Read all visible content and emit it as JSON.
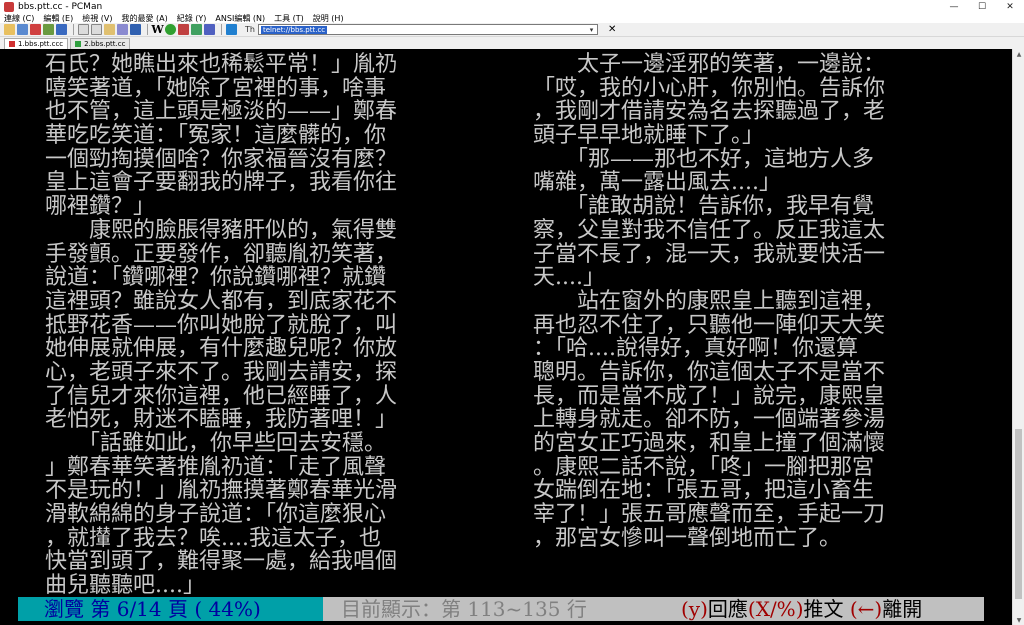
{
  "window": {
    "title": "bbs.ptt.cc - PCMan",
    "controls": [
      "—",
      "☐",
      "✕"
    ]
  },
  "menu": {
    "items": [
      "連線 (C)",
      "編輯 (E)",
      "檢視 (V)",
      "我的最愛 (A)",
      "紀錄 (Y)",
      "ANSI編輯 (N)",
      "工具 (T)",
      "說明 (H)"
    ]
  },
  "toolbar": {
    "address_label": "Th",
    "address_value": "telnet://bbs.ptt.cc",
    "close_label": "✕",
    "w_label": "W"
  },
  "tabs": [
    {
      "label": "1.bbs.ptt.ccc"
    },
    {
      "label": "2.bbs.ptt.cc"
    }
  ],
  "article": {
    "left_lines": [
      "石氏？她瞧出來也稀鬆平常！」胤礽",
      "嘻笑著道，「她除了宮裡的事，啥事",
      "也不管，這上頭是極淡的——」鄭春",
      "華吃吃笑道：「冤家！這麼髒的，你",
      "一個勁掏摸個啥？你家福晉沒有麼？",
      "皇上這會子要翻我的牌子，我看你往",
      "哪裡鑽？」",
      "　　康熙的臉脹得豬肝似的，氣得雙",
      "手發顫。正要發作，卻聽胤礽笑著，",
      "說道：「鑽哪裡？你說鑽哪裡？就鑽",
      "這裡頭？雖說女人都有，到底家花不",
      "抵野花香——你叫她脫了就脫了，叫",
      "她伸展就伸展，有什麼趣兒呢？你放",
      "心，老頭子來不了。我剛去請安，探",
      "了信兒才來你這裡，他已經睡了，人",
      "老怕死，財迷不瞌睡，我防著哩！」",
      "　　「話雖如此，你早些回去安穩。",
      "」鄭春華笑著推胤礽道：「走了風聲",
      "不是玩的！」胤礽撫摸著鄭春華光滑",
      "滑軟綿綿的身子說道：「你這麼狠心",
      "，就攆了我去？唉....我這太子，也",
      "快當到頭了，難得聚一處，給我唱個",
      "曲兒聽聽吧....」"
    ],
    "right_lines": [
      "　　太子一邊淫邪的笑著，一邊說：",
      "「哎，我的小心肝，你別怕。告訴你",
      "，我剛才借請安為名去探聽過了，老",
      "頭子早早地就睡下了。」",
      "　　「那——那也不好，這地方人多",
      "嘴雜，萬一露出風去....」",
      "　　「誰敢胡說！告訴你，我早有覺",
      "察，父皇對我不信任了。反正我這太",
      "子當不長了，混一天，我就要快活一",
      "天....」",
      "　　站在窗外的康熙皇上聽到這裡，",
      "再也忍不住了，只聽他一陣仰天大笑",
      "：「哈....說得好，真好啊！你還算",
      "聰明。告訴你，你這個太子不是當不",
      "長，而是當不成了！」說完，康熙皇",
      "上轉身就走。卻不防，一個端著參湯",
      "的宮女正巧過來，和皇上撞了個滿懷",
      "。康熙二話不說，「咚」一腳把那宮",
      "女踹倒在地：「張五哥，把這小畜生",
      "宰了！」張五哥應聲而至，手起一刀",
      "，那宮女慘叫一聲倒地而亡了。"
    ]
  },
  "status": {
    "browse": "瀏覽 第 6/14 頁 ( 44%)",
    "display": "目前顯示：第 113~135 行",
    "reply_key": "(y)",
    "reply_label": "回應",
    "push_key": "(X/%)",
    "push_label": "推文",
    "leave_key": "(←)",
    "leave_label": "離開"
  },
  "colors": {
    "terminal_bg": "#000000",
    "terminal_fg": "#c8c8c8",
    "status_browse_bg": "#00a0a8",
    "status_browse_fg": "#0000a0",
    "status_bg": "#c0c0c0",
    "status_key": "#a00000"
  }
}
